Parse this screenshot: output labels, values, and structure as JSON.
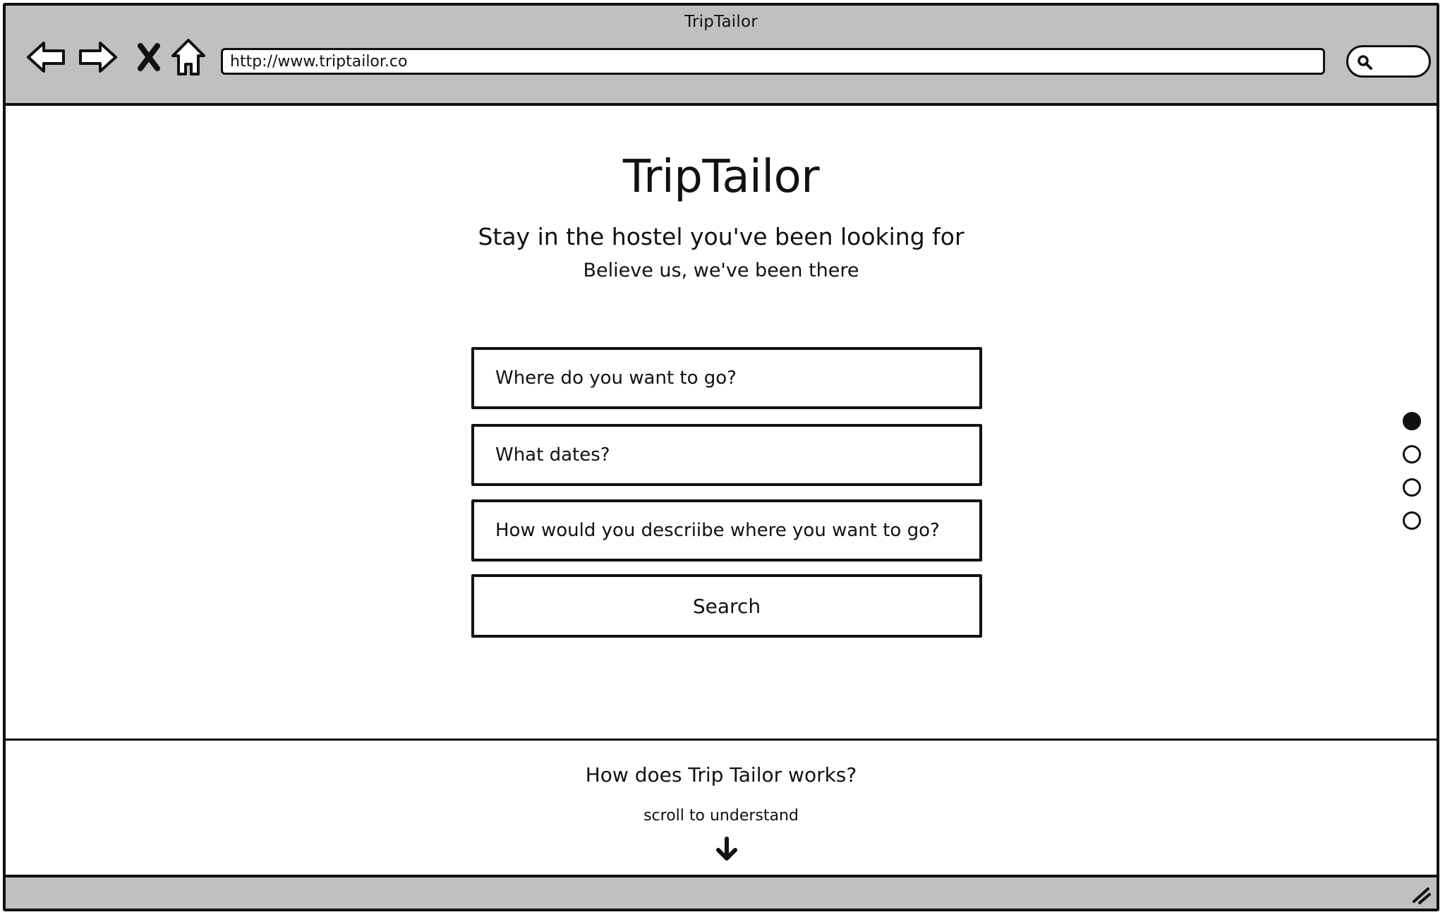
{
  "window": {
    "title": "TripTailor"
  },
  "toolbar": {
    "back_icon": "back-arrow-icon",
    "forward_icon": "forward-arrow-icon",
    "stop_icon": "close-icon",
    "home_icon": "home-icon",
    "address": "http://www.triptailor.co",
    "search_icon": "search-icon"
  },
  "hero": {
    "brand": "TripTailor",
    "tagline": "Stay in the hostel you've been looking for",
    "subtagline": "Believe us, we've been there"
  },
  "search_form": {
    "destination_placeholder": "Where do you want to go?",
    "dates_placeholder": "What dates?",
    "description_placeholder": "How would you descriibe where you want to go?",
    "search_label": "Search"
  },
  "pagination": {
    "count": 4,
    "active_index": 0
  },
  "how_it_works": {
    "title": "How does Trip Tailor works?",
    "subtitle": "scroll to understand",
    "arrow_icon": "arrow-down-icon"
  },
  "colors": {
    "chrome": "#c0c0c0",
    "ink": "#111111",
    "background": "#ffffff"
  }
}
